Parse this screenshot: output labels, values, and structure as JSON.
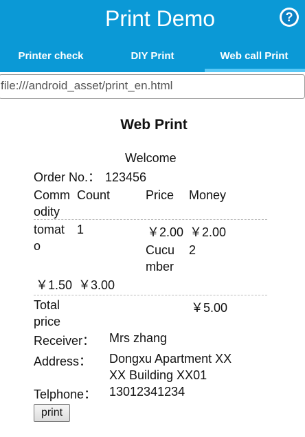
{
  "app": {
    "title": "Print Demo",
    "help_icon_glyph": "?"
  },
  "tabs": [
    {
      "label": "Printer check"
    },
    {
      "label": "DIY Print"
    },
    {
      "label": "Web call Print"
    }
  ],
  "url": {
    "value": "file:///android_asset/print_en.html"
  },
  "page": {
    "heading": "Web Print",
    "welcome": "Welcome",
    "order_label": "Order No.：",
    "order_value": "123456",
    "headers": {
      "commodity_1": "Comm",
      "commodity_2": "odity",
      "count": "Count",
      "price": "Price",
      "money": "Money"
    },
    "row1": {
      "name_1": "tomat",
      "name_2": "o",
      "count": "1",
      "price": "￥2.00",
      "money": "￥2.00"
    },
    "row2": {
      "name_1": "Cucu",
      "name_2": "mber",
      "count": "2",
      "price": "￥1.50",
      "money": "￥3.00"
    },
    "total_1": "Total",
    "total_2": "price",
    "total_value": "￥5.00",
    "receiver_label": "Receiver：",
    "receiver_value": "Mrs zhang",
    "address_label": "Address：",
    "address_line1": "Dongxu Apartment XX",
    "address_line2": "XX Building XX01",
    "phone_label": "Telphone：",
    "phone_value": "13012341234",
    "print_button": "print"
  },
  "colors": {
    "appbar": "#0b99d6",
    "tab_indicator": "#5ac8f5"
  }
}
